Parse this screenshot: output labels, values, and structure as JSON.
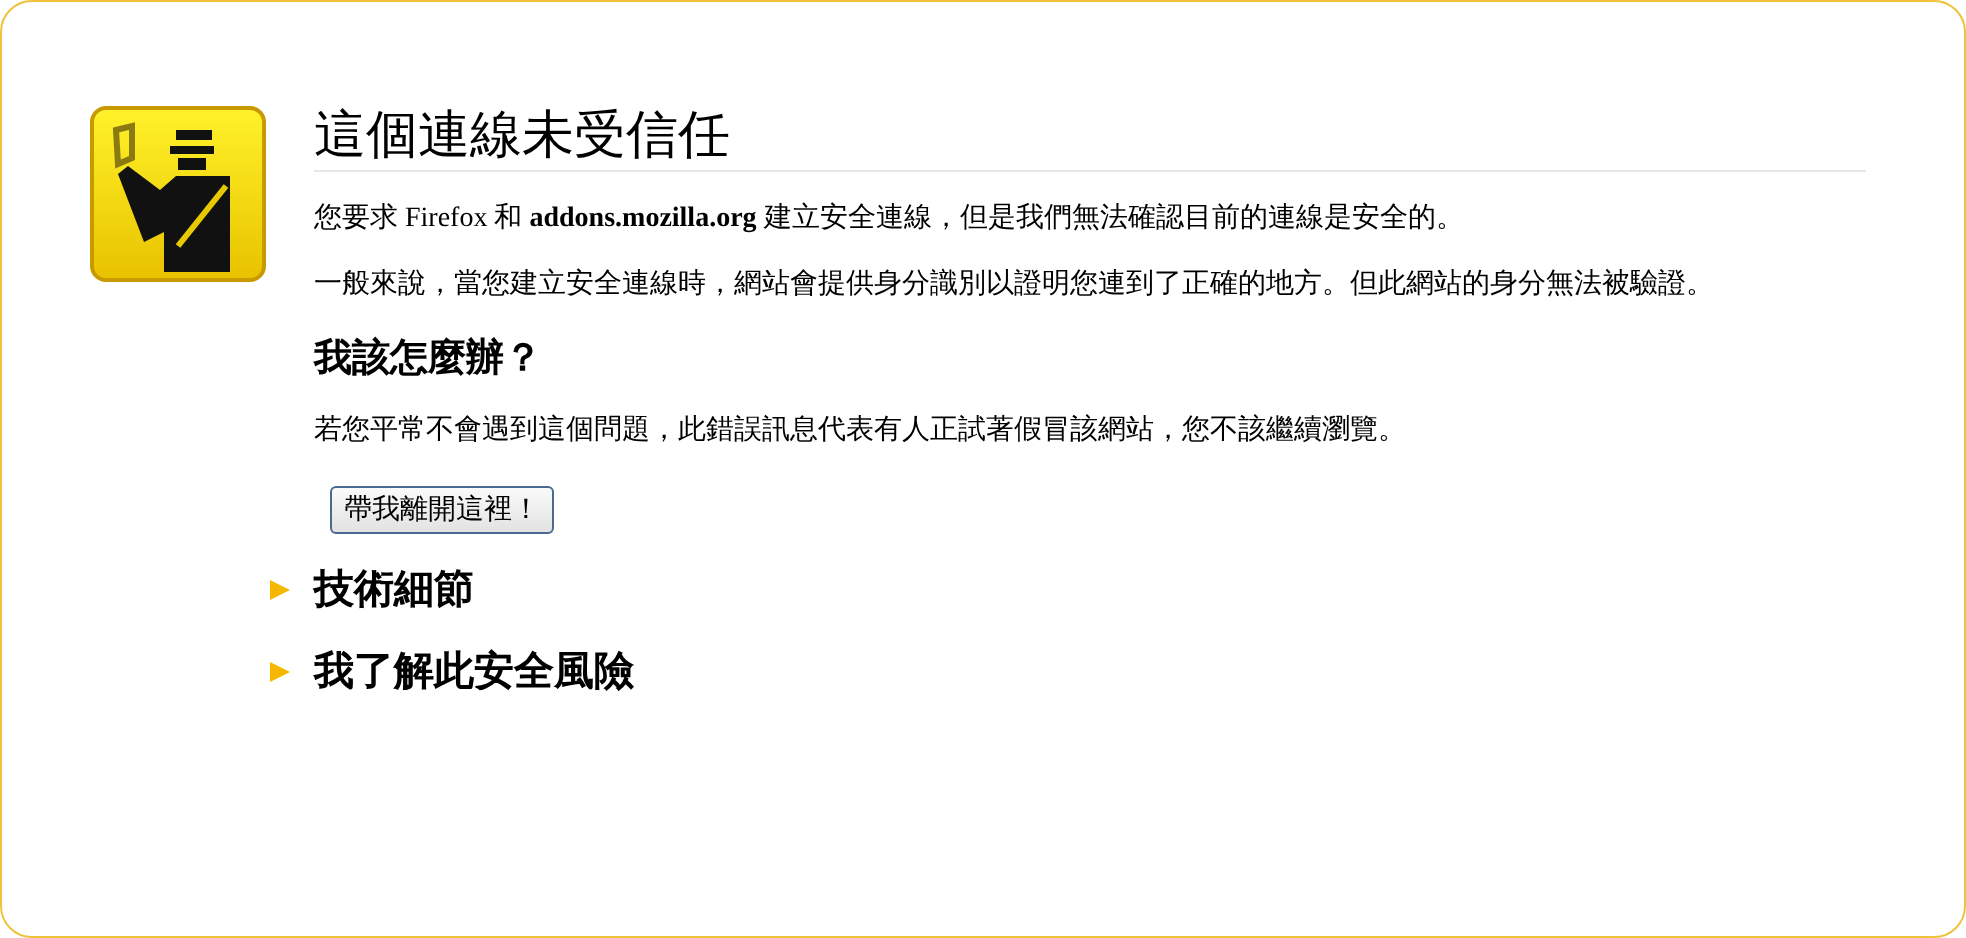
{
  "title": "這個連線未受信任",
  "paragraphs": [
    "您要求 Firefox 和 **addons.mozilla.org** 建立安全連線，但是我們無法確認目前的連線是安全的。",
    "一般來說，當您建立安全連線時，網站會提供身分識別以證明您連到了正確的地方。但此網站的身分無法被驗證。"
  ],
  "section": {
    "heading": "我該怎麼辦？",
    "text": "若您平常不會遇到這個問題，此錯誤訊息代表有人正試著假冒該網站，您不該繼續瀏覽。",
    "button": "帶我離開這裡！"
  },
  "expanders": [
    {
      "label": "技術細節",
      "expanded": false
    },
    {
      "label": "我了解此安全風險",
      "expanded": false
    }
  ]
}
